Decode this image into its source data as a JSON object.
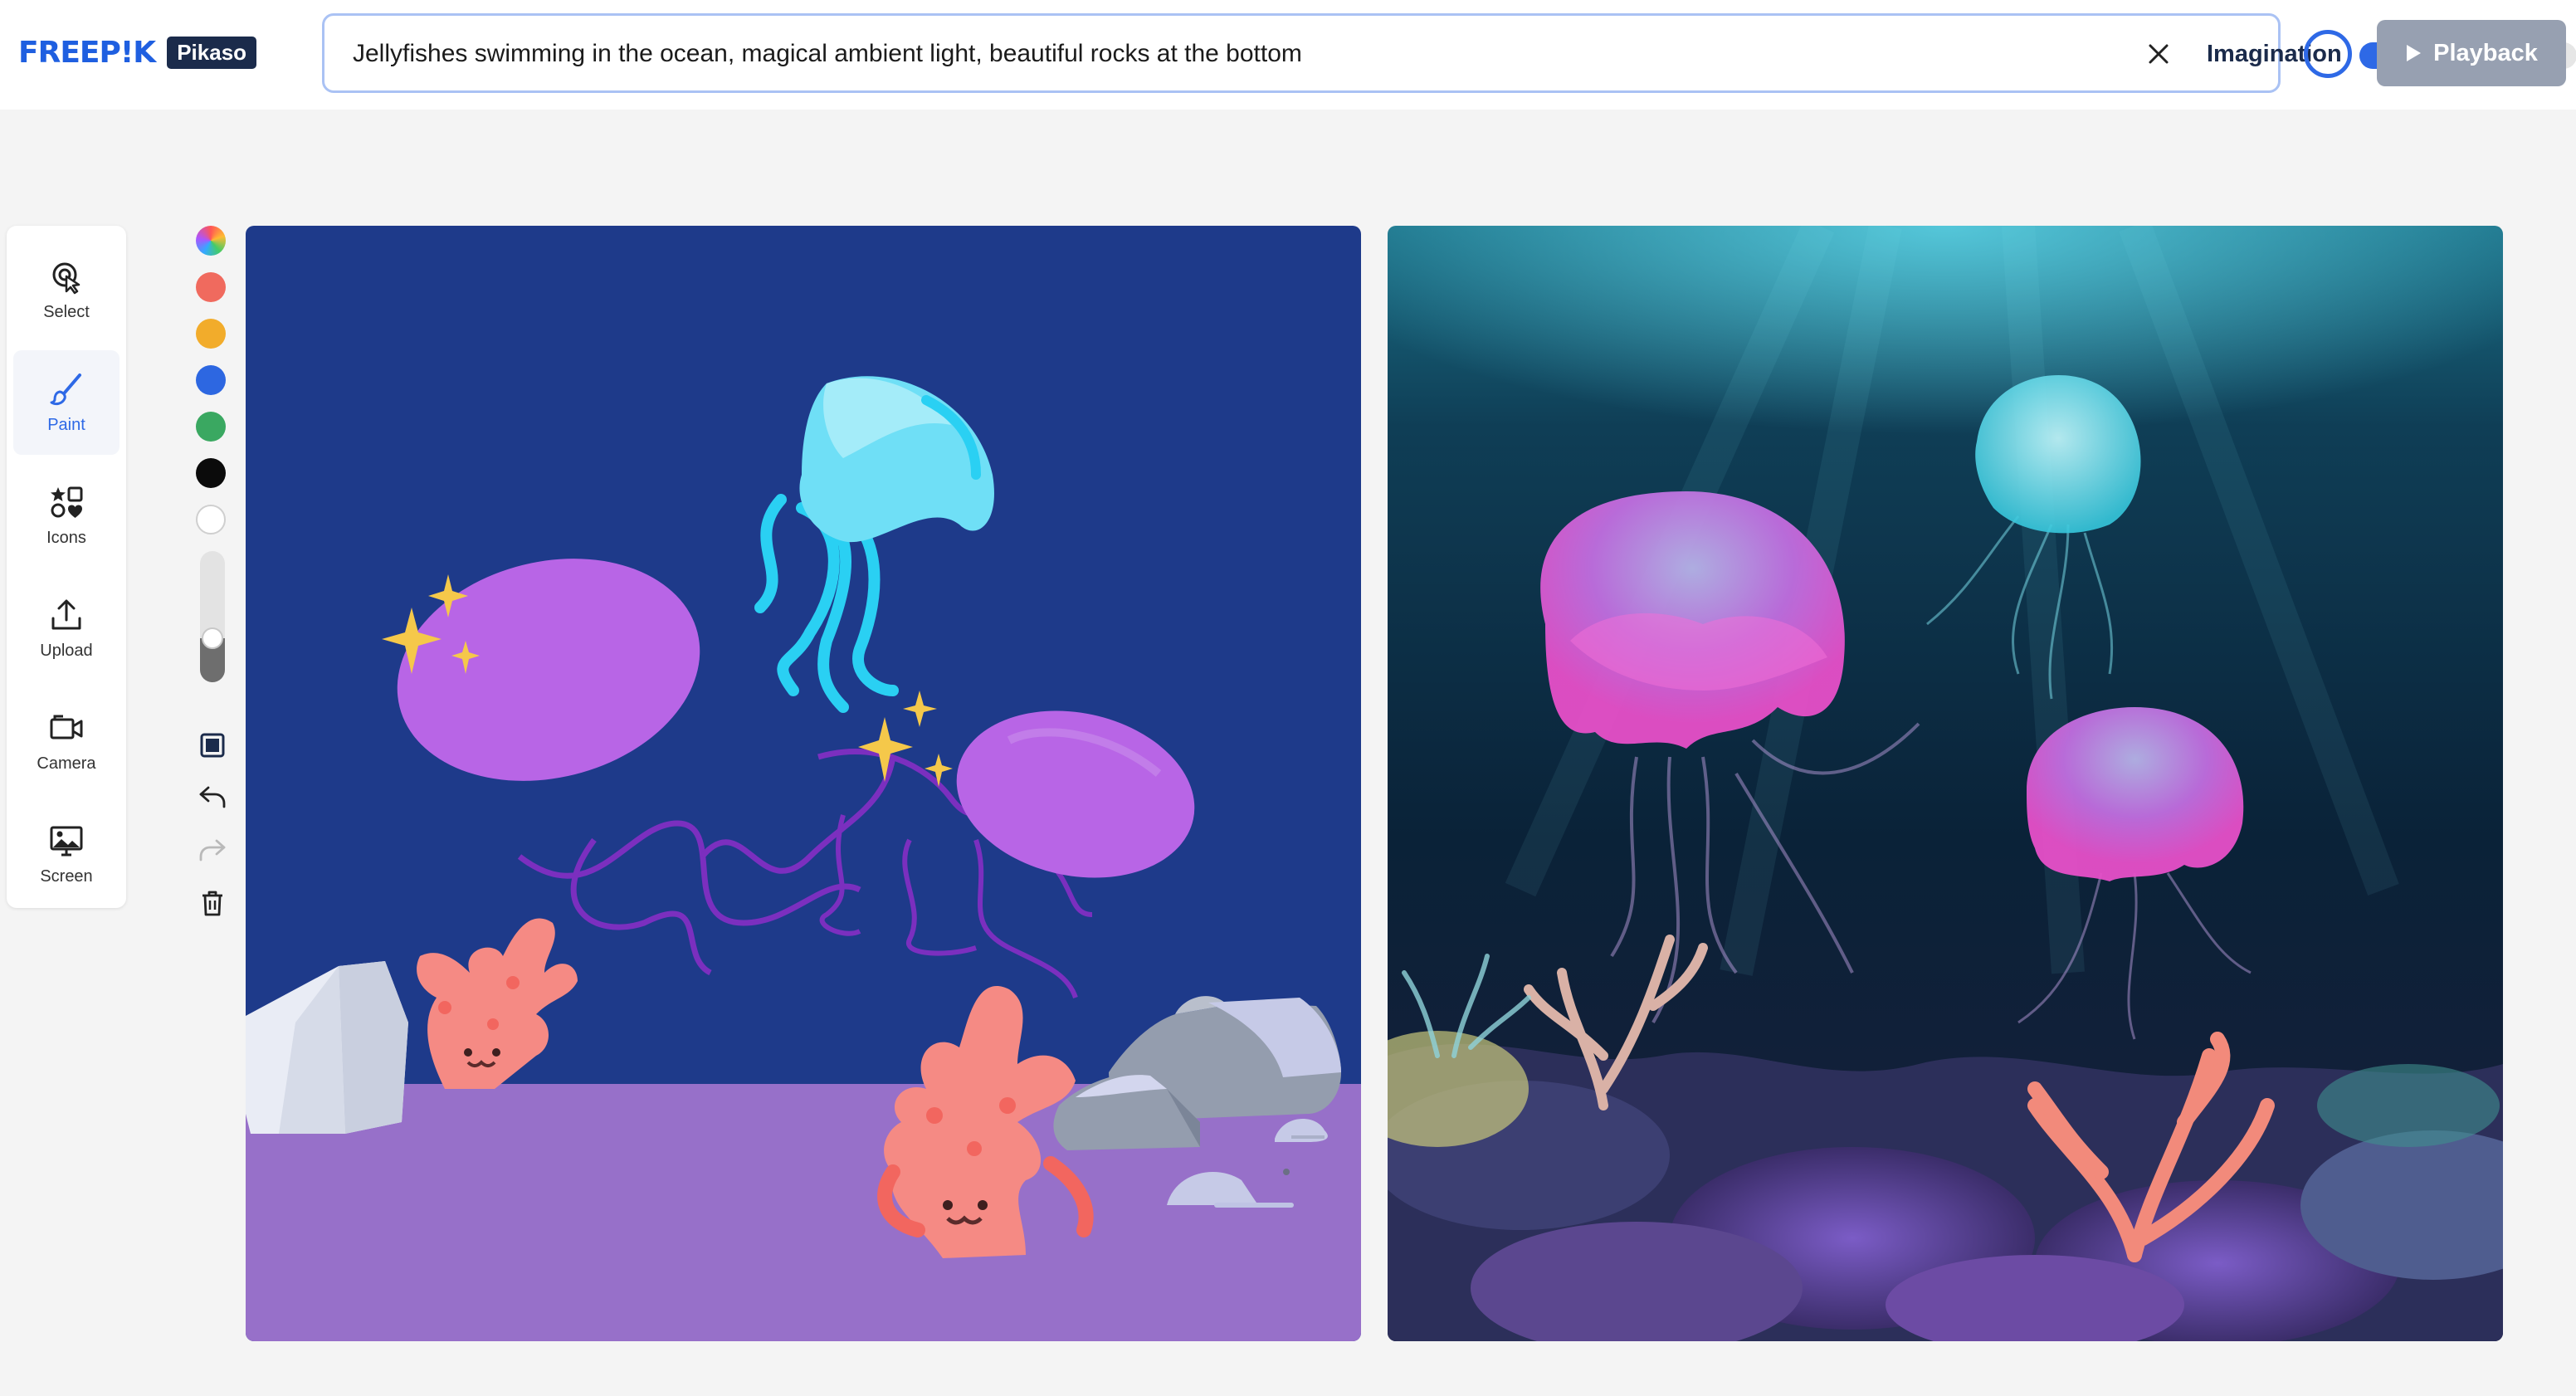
{
  "brand": {
    "logo_text": "FREEP!K",
    "product": "Pikaso"
  },
  "prompt": {
    "value": "Jellyfishes swimming in the ocean, magical ambient light, beautiful rocks at the bottom",
    "placeholder": ""
  },
  "imagination": {
    "label": "Imagination",
    "level_percent": 83
  },
  "playback": {
    "label": "Playback"
  },
  "tools": [
    {
      "label": "Select",
      "icon": "select-pointer-icon"
    },
    {
      "label": "Paint",
      "icon": "paint-brush-icon"
    },
    {
      "label": "Icons",
      "icon": "shapes-icon"
    },
    {
      "label": "Upload",
      "icon": "upload-icon"
    },
    {
      "label": "Camera",
      "icon": "camera-icon"
    },
    {
      "label": "Screen",
      "icon": "screen-capture-icon"
    }
  ],
  "palette": {
    "colors": [
      "#f06a5e",
      "#f2ac2b",
      "#2d67e1",
      "#3aa861",
      "#0b0b0b",
      "#ffffff"
    ],
    "brush_size_fraction": 0.3
  },
  "colors": {
    "accent": "#2e69e6",
    "sketch_ocean": "#1e3a8a",
    "sketch_floor": "#9770c9"
  }
}
